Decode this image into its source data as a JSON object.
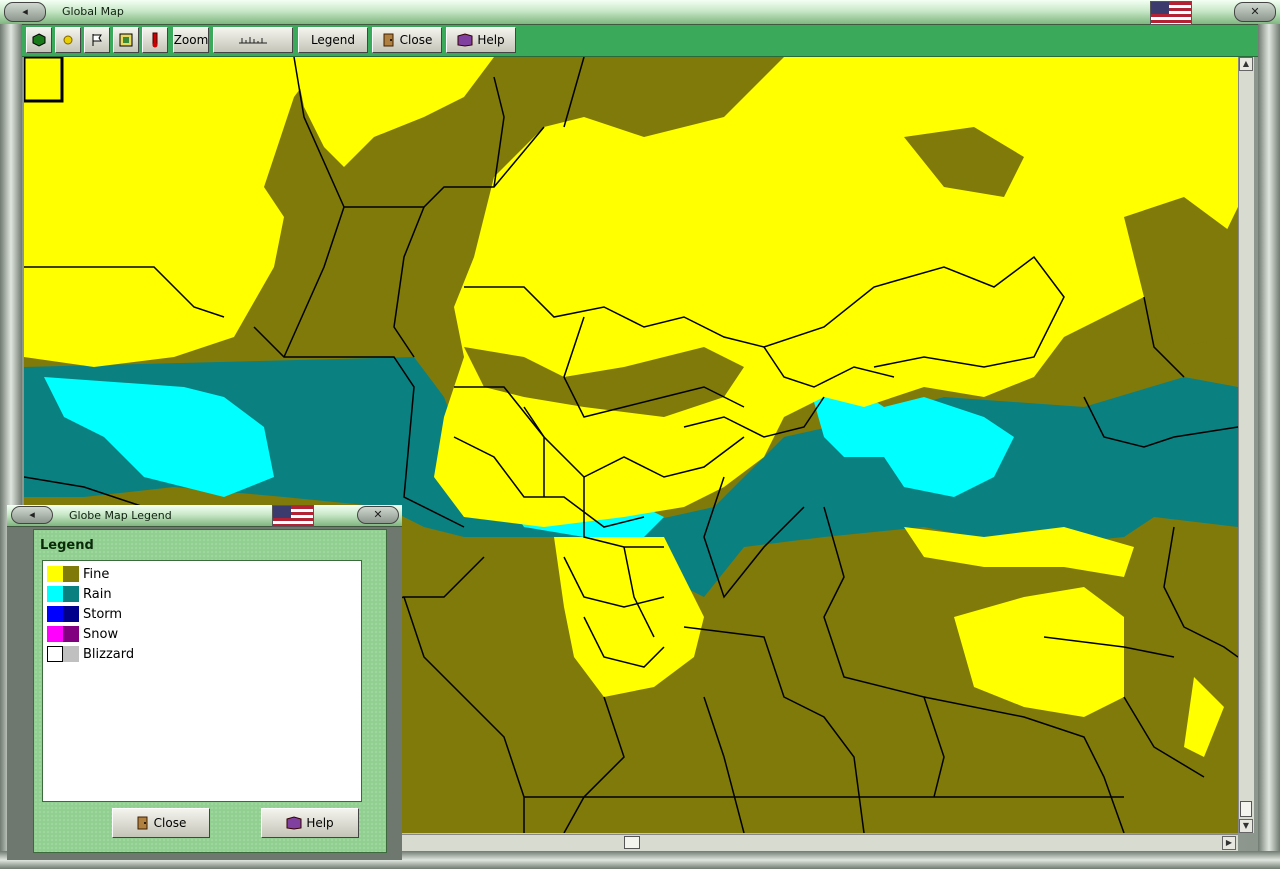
{
  "window": {
    "title": "Global Map"
  },
  "toolbar": {
    "zoom_label": "Zoom",
    "legend_label": "Legend",
    "close_label": "Close",
    "help_label": "Help"
  },
  "legend_window": {
    "title": "Globe Map Legend",
    "heading": "Legend",
    "items": [
      {
        "label": "Fine",
        "light": "#ffff00",
        "dark": "#7f7a0a"
      },
      {
        "label": "Rain",
        "light": "#00ffff",
        "dark": "#0a8080"
      },
      {
        "label": "Storm",
        "light": "#0000ff",
        "dark": "#00008b"
      },
      {
        "label": "Snow",
        "light": "#ff00ff",
        "dark": "#800080"
      },
      {
        "label": "Blizzard",
        "light": "#ffffff",
        "dark": "#c0c0c0"
      }
    ],
    "close_label": "Close",
    "help_label": "Help"
  },
  "colors": {
    "fine": "#ffff00",
    "fine_dark": "#7f7a0a",
    "rain": "#00ffff",
    "rain_dark": "#0a8080",
    "toolbar": "#3aa95a"
  }
}
